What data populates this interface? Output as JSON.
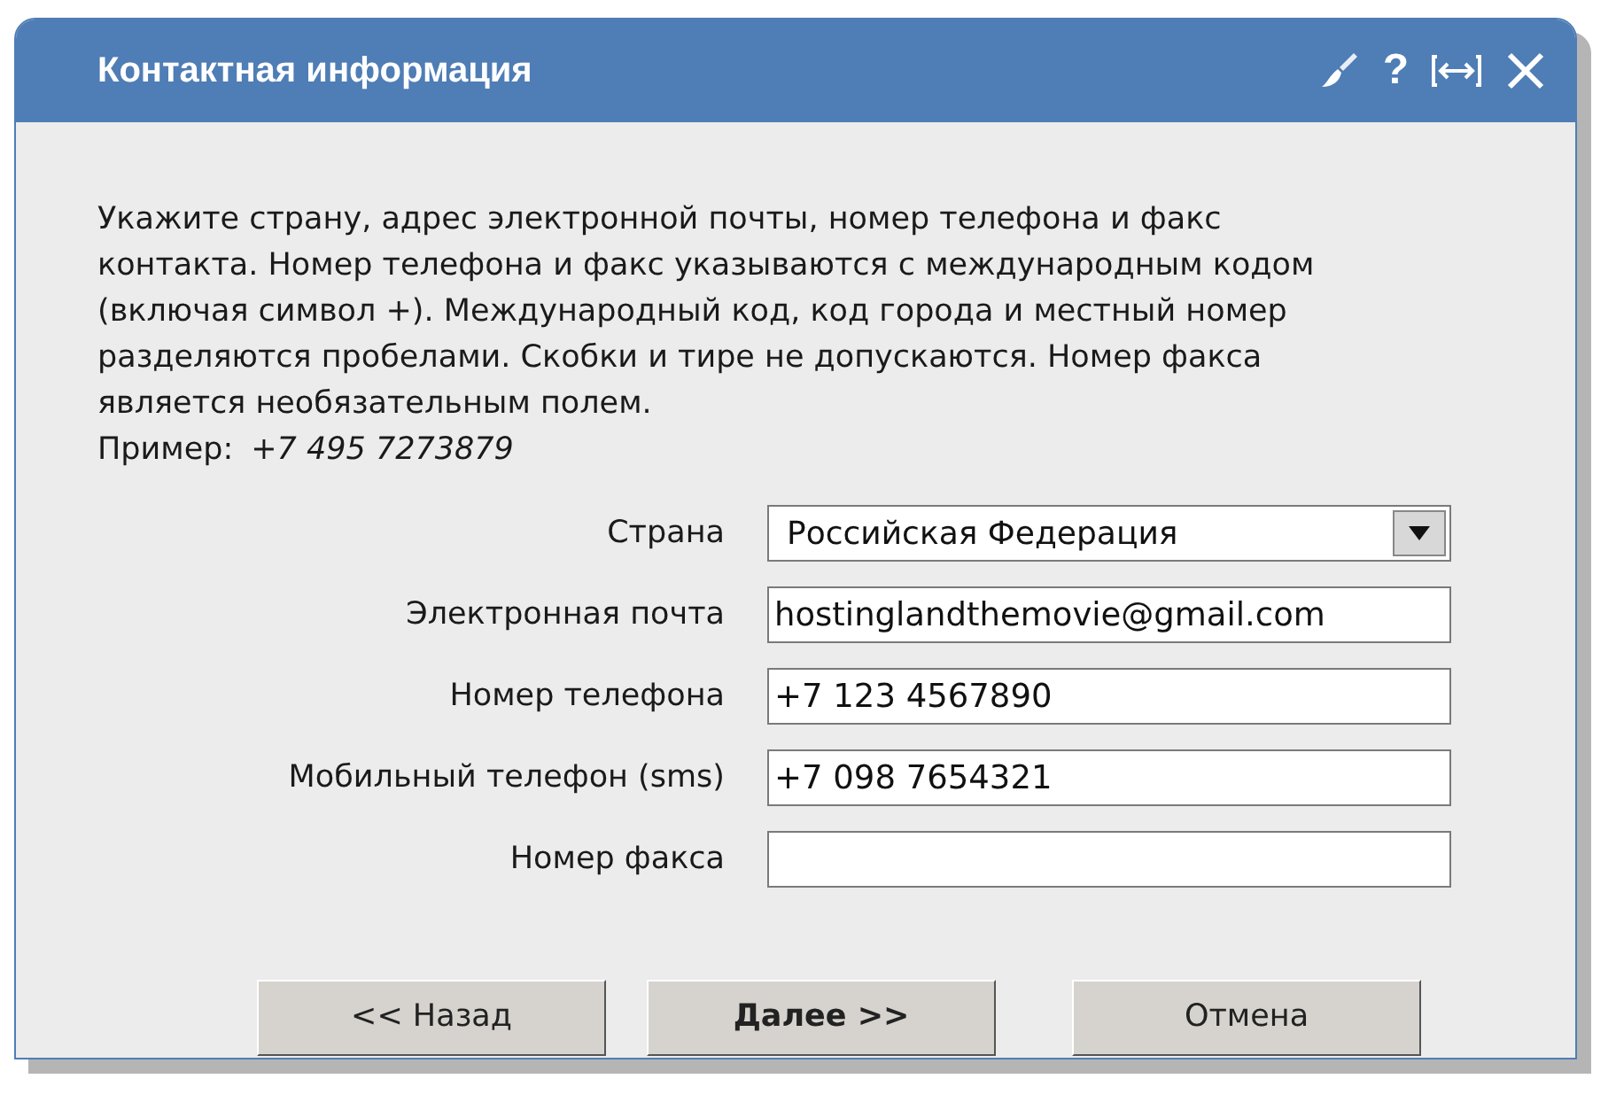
{
  "window": {
    "title": "Контактная информация",
    "controls": [
      {
        "kind": "brush"
      },
      {
        "kind": "help",
        "label": "?"
      },
      {
        "kind": "resize"
      },
      {
        "kind": "close"
      }
    ]
  },
  "instructions": "Укажите страну, адрес электронной почты, номер телефона и факс контакта. Номер телефона и факс указываются с международным кодом (включая символ +). Международный код, код города и местный номер разделяются пробелами. Скобки и тире не допускаются. Номер факса является необязательным полем.",
  "example": {
    "label": "Пример:",
    "value": "+7 495 7273879"
  },
  "fields": [
    {
      "kind": "dropdown",
      "label": "Страна",
      "value": "Российская Федерация"
    },
    {
      "kind": "text",
      "label": "Электронная почта",
      "value": "hostinglandthemovie@gmail.com"
    },
    {
      "kind": "text",
      "label": "Номер телефона",
      "value": "+7 123 4567890"
    },
    {
      "kind": "text",
      "label": "Мобильный телефон (sms)",
      "value": "+7 098 7654321"
    },
    {
      "kind": "text",
      "label": "Номер факса"
    }
  ],
  "buttons": [
    {
      "label": "<< Назад",
      "default": false
    },
    {
      "label": "Далее >>",
      "default": true
    },
    {
      "label": "Отмена",
      "default": false
    }
  ]
}
